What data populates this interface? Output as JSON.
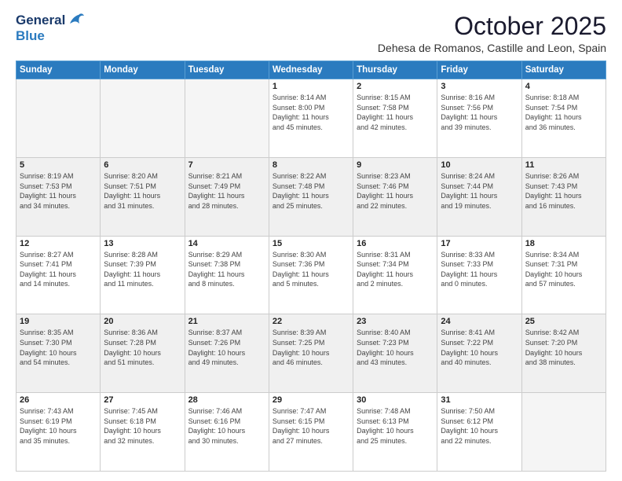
{
  "logo": {
    "line1": "General",
    "line2": "Blue"
  },
  "header": {
    "month": "October 2025",
    "location": "Dehesa de Romanos, Castille and Leon, Spain"
  },
  "weekdays": [
    "Sunday",
    "Monday",
    "Tuesday",
    "Wednesday",
    "Thursday",
    "Friday",
    "Saturday"
  ],
  "weeks": [
    [
      {
        "day": "",
        "info": ""
      },
      {
        "day": "",
        "info": ""
      },
      {
        "day": "",
        "info": ""
      },
      {
        "day": "1",
        "info": "Sunrise: 8:14 AM\nSunset: 8:00 PM\nDaylight: 11 hours\nand 45 minutes."
      },
      {
        "day": "2",
        "info": "Sunrise: 8:15 AM\nSunset: 7:58 PM\nDaylight: 11 hours\nand 42 minutes."
      },
      {
        "day": "3",
        "info": "Sunrise: 8:16 AM\nSunset: 7:56 PM\nDaylight: 11 hours\nand 39 minutes."
      },
      {
        "day": "4",
        "info": "Sunrise: 8:18 AM\nSunset: 7:54 PM\nDaylight: 11 hours\nand 36 minutes."
      }
    ],
    [
      {
        "day": "5",
        "info": "Sunrise: 8:19 AM\nSunset: 7:53 PM\nDaylight: 11 hours\nand 34 minutes."
      },
      {
        "day": "6",
        "info": "Sunrise: 8:20 AM\nSunset: 7:51 PM\nDaylight: 11 hours\nand 31 minutes."
      },
      {
        "day": "7",
        "info": "Sunrise: 8:21 AM\nSunset: 7:49 PM\nDaylight: 11 hours\nand 28 minutes."
      },
      {
        "day": "8",
        "info": "Sunrise: 8:22 AM\nSunset: 7:48 PM\nDaylight: 11 hours\nand 25 minutes."
      },
      {
        "day": "9",
        "info": "Sunrise: 8:23 AM\nSunset: 7:46 PM\nDaylight: 11 hours\nand 22 minutes."
      },
      {
        "day": "10",
        "info": "Sunrise: 8:24 AM\nSunset: 7:44 PM\nDaylight: 11 hours\nand 19 minutes."
      },
      {
        "day": "11",
        "info": "Sunrise: 8:26 AM\nSunset: 7:43 PM\nDaylight: 11 hours\nand 16 minutes."
      }
    ],
    [
      {
        "day": "12",
        "info": "Sunrise: 8:27 AM\nSunset: 7:41 PM\nDaylight: 11 hours\nand 14 minutes."
      },
      {
        "day": "13",
        "info": "Sunrise: 8:28 AM\nSunset: 7:39 PM\nDaylight: 11 hours\nand 11 minutes."
      },
      {
        "day": "14",
        "info": "Sunrise: 8:29 AM\nSunset: 7:38 PM\nDaylight: 11 hours\nand 8 minutes."
      },
      {
        "day": "15",
        "info": "Sunrise: 8:30 AM\nSunset: 7:36 PM\nDaylight: 11 hours\nand 5 minutes."
      },
      {
        "day": "16",
        "info": "Sunrise: 8:31 AM\nSunset: 7:34 PM\nDaylight: 11 hours\nand 2 minutes."
      },
      {
        "day": "17",
        "info": "Sunrise: 8:33 AM\nSunset: 7:33 PM\nDaylight: 11 hours\nand 0 minutes."
      },
      {
        "day": "18",
        "info": "Sunrise: 8:34 AM\nSunset: 7:31 PM\nDaylight: 10 hours\nand 57 minutes."
      }
    ],
    [
      {
        "day": "19",
        "info": "Sunrise: 8:35 AM\nSunset: 7:30 PM\nDaylight: 10 hours\nand 54 minutes."
      },
      {
        "day": "20",
        "info": "Sunrise: 8:36 AM\nSunset: 7:28 PM\nDaylight: 10 hours\nand 51 minutes."
      },
      {
        "day": "21",
        "info": "Sunrise: 8:37 AM\nSunset: 7:26 PM\nDaylight: 10 hours\nand 49 minutes."
      },
      {
        "day": "22",
        "info": "Sunrise: 8:39 AM\nSunset: 7:25 PM\nDaylight: 10 hours\nand 46 minutes."
      },
      {
        "day": "23",
        "info": "Sunrise: 8:40 AM\nSunset: 7:23 PM\nDaylight: 10 hours\nand 43 minutes."
      },
      {
        "day": "24",
        "info": "Sunrise: 8:41 AM\nSunset: 7:22 PM\nDaylight: 10 hours\nand 40 minutes."
      },
      {
        "day": "25",
        "info": "Sunrise: 8:42 AM\nSunset: 7:20 PM\nDaylight: 10 hours\nand 38 minutes."
      }
    ],
    [
      {
        "day": "26",
        "info": "Sunrise: 7:43 AM\nSunset: 6:19 PM\nDaylight: 10 hours\nand 35 minutes."
      },
      {
        "day": "27",
        "info": "Sunrise: 7:45 AM\nSunset: 6:18 PM\nDaylight: 10 hours\nand 32 minutes."
      },
      {
        "day": "28",
        "info": "Sunrise: 7:46 AM\nSunset: 6:16 PM\nDaylight: 10 hours\nand 30 minutes."
      },
      {
        "day": "29",
        "info": "Sunrise: 7:47 AM\nSunset: 6:15 PM\nDaylight: 10 hours\nand 27 minutes."
      },
      {
        "day": "30",
        "info": "Sunrise: 7:48 AM\nSunset: 6:13 PM\nDaylight: 10 hours\nand 25 minutes."
      },
      {
        "day": "31",
        "info": "Sunrise: 7:50 AM\nSunset: 6:12 PM\nDaylight: 10 hours\nand 22 minutes."
      },
      {
        "day": "",
        "info": ""
      }
    ]
  ]
}
